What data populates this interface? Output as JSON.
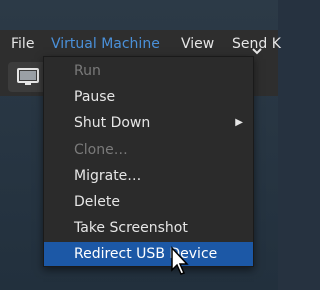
{
  "menubar": {
    "items": [
      {
        "label": "File"
      },
      {
        "label": "Virtual Machine"
      },
      {
        "label": "View"
      },
      {
        "label": "Send K"
      }
    ]
  },
  "toolbar": {
    "console_icon": "monitor-icon"
  },
  "menu": {
    "items": [
      {
        "label": "Run",
        "enabled": false
      },
      {
        "label": "Pause",
        "enabled": true
      },
      {
        "label": "Shut Down",
        "enabled": true,
        "submenu": true
      },
      {
        "label": "Clone…",
        "enabled": false
      },
      {
        "label": "Migrate…",
        "enabled": true
      },
      {
        "label": "Delete",
        "enabled": true
      },
      {
        "label": "Take Screenshot",
        "enabled": true
      },
      {
        "label": "Redirect USB Device",
        "enabled": true,
        "highlighted": true
      }
    ]
  },
  "colors": {
    "accent": "#4a90d9",
    "highlight": "#1c58a6",
    "disabled": "#7a7a7a"
  }
}
